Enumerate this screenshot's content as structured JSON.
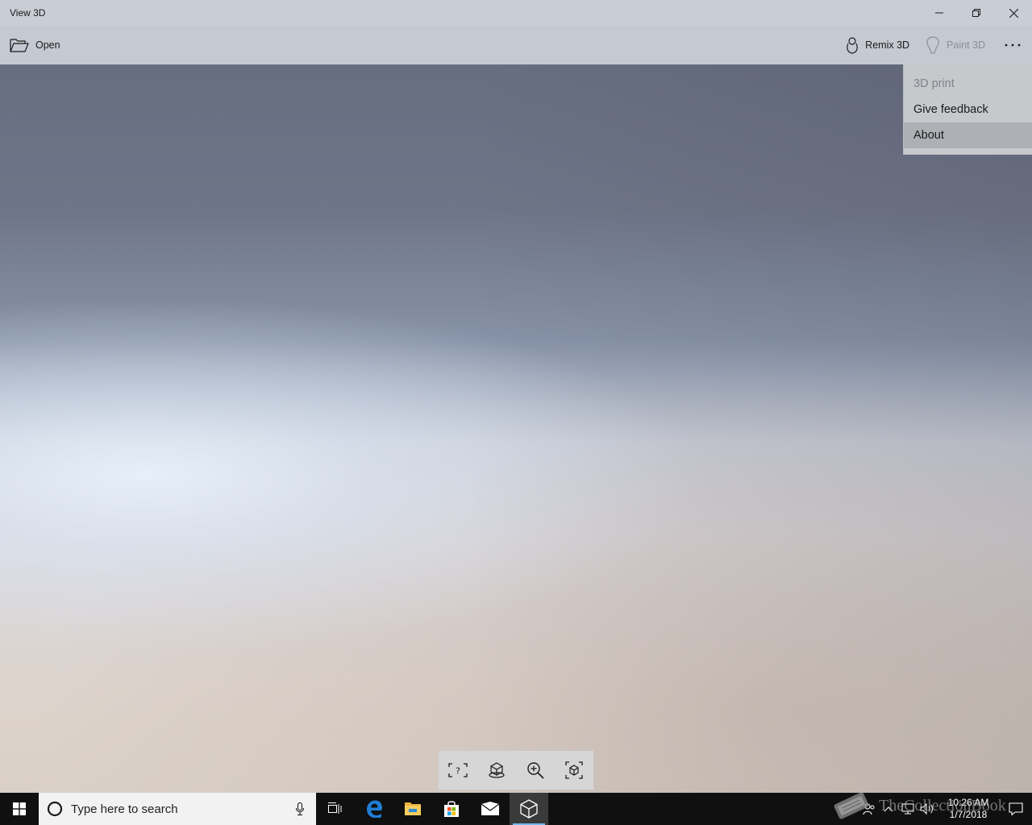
{
  "window": {
    "title": "View 3D",
    "controls": {
      "minimize": "minimize-icon",
      "restore": "restore-icon",
      "close": "close-icon"
    }
  },
  "commandbar": {
    "open_label": "Open",
    "remix_label": "Remix 3D",
    "paint_label": "Paint 3D",
    "more_icon": "more-icon"
  },
  "menu": {
    "items": [
      {
        "label": "3D print",
        "state": "disabled"
      },
      {
        "label": "Give feedback",
        "state": "normal"
      },
      {
        "label": "About",
        "state": "hover"
      }
    ]
  },
  "toolbar": {
    "tools": [
      "help-frame-icon",
      "environment-icon",
      "zoom-icon",
      "fit-object-icon"
    ]
  },
  "taskbar": {
    "search_placeholder": "Type here to search",
    "apps": [
      "task-view-icon",
      "edge-icon",
      "file-explorer-icon",
      "store-icon",
      "mail-icon",
      "view-3d-icon"
    ],
    "active_app": "view-3d-icon",
    "clock_time": "10:26 AM",
    "clock_date": "1/7/2018",
    "accent_color": "#76b9ed"
  },
  "watermark": {
    "text": "TheCollectionBook"
  }
}
